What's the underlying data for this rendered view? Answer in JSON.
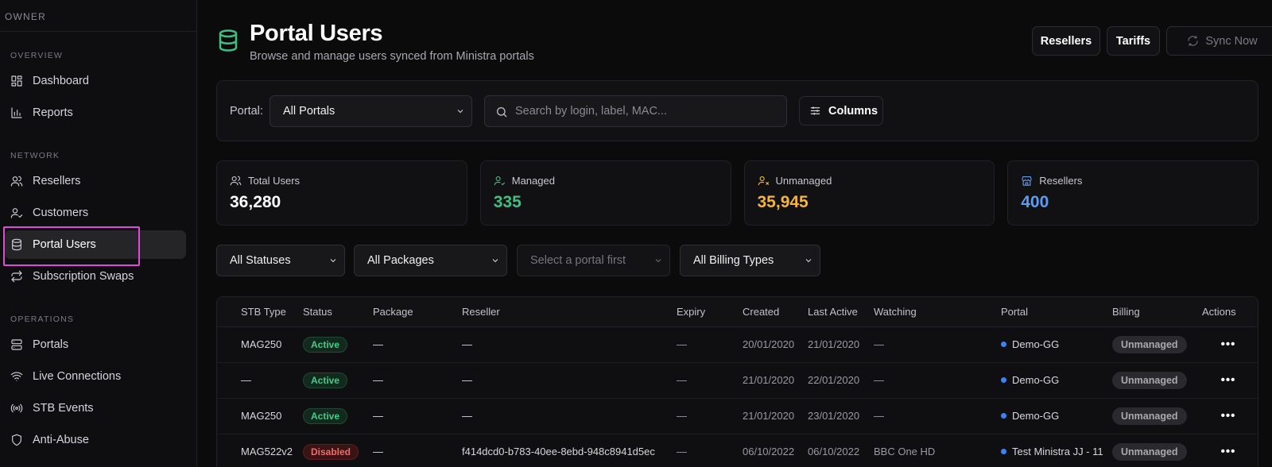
{
  "sidebar": {
    "owner": "OWNER",
    "sections": [
      {
        "label": "OVERVIEW",
        "items": [
          {
            "label": "Dashboard",
            "icon": "dashboard-icon"
          },
          {
            "label": "Reports",
            "icon": "bar-chart-icon"
          }
        ]
      },
      {
        "label": "NETWORK",
        "items": [
          {
            "label": "Resellers",
            "icon": "users-icon"
          },
          {
            "label": "Customers",
            "icon": "user-check-icon"
          },
          {
            "label": "Portal Users",
            "icon": "database-icon",
            "active": true
          },
          {
            "label": "Subscription Swaps",
            "icon": "repeat-icon"
          }
        ]
      },
      {
        "label": "OPERATIONS",
        "items": [
          {
            "label": "Portals",
            "icon": "server-icon"
          },
          {
            "label": "Live Connections",
            "icon": "wifi-icon"
          },
          {
            "label": "STB Events",
            "icon": "broadcast-icon"
          },
          {
            "label": "Anti-Abuse",
            "icon": "shield-icon"
          }
        ]
      }
    ]
  },
  "header": {
    "title": "Portal Users",
    "subtitle": "Browse and manage users synced from Ministra portals",
    "resellers_btn": "Resellers",
    "tariffs_btn": "Tariffs",
    "sync_btn": "Sync Now"
  },
  "filter_bar": {
    "portal_label": "Portal:",
    "portal_value": "All Portals",
    "search_placeholder": "Search by login, label, MAC...",
    "columns_btn": "Columns"
  },
  "stats": [
    {
      "label": "Total Users",
      "value": "36,280",
      "color": "#ffffff",
      "icon": "users-icon"
    },
    {
      "label": "Managed",
      "value": "335",
      "color": "#3fbf86",
      "icon": "user-check-icon"
    },
    {
      "label": "Unmanaged",
      "value": "35,945",
      "color": "#f5b638",
      "icon": "user-x-icon"
    },
    {
      "label": "Resellers",
      "value": "400",
      "color": "#5b9cf5",
      "icon": "store-icon"
    }
  ],
  "filters": {
    "status": "All Statuses",
    "packages": "All Packages",
    "portal_first": "Select a portal first",
    "billing": "All Billing Types"
  },
  "table": {
    "headers": [
      "STB Type",
      "Status",
      "Package",
      "Reseller",
      "Expiry",
      "Created",
      "Last Active",
      "Watching",
      "Portal",
      "Billing",
      "Actions"
    ],
    "rows": [
      {
        "stb": "MAG250",
        "status": "Active",
        "package": "—",
        "reseller": "—",
        "expiry": "—",
        "created": "20/01/2020",
        "last_active": "21/01/2020",
        "watching": "—",
        "portal": "Demo-GG",
        "billing": "Unmanaged"
      },
      {
        "stb": "—",
        "status": "Active",
        "package": "—",
        "reseller": "—",
        "expiry": "—",
        "created": "21/01/2020",
        "last_active": "22/01/2020",
        "watching": "—",
        "portal": "Demo-GG",
        "billing": "Unmanaged"
      },
      {
        "stb": "MAG250",
        "status": "Active",
        "package": "—",
        "reseller": "—",
        "expiry": "—",
        "created": "21/01/2020",
        "last_active": "23/01/2020",
        "watching": "—",
        "portal": "Demo-GG",
        "billing": "Unmanaged"
      },
      {
        "stb": "MAG522v2",
        "status": "Disabled",
        "package": "—",
        "reseller": "f414dcd0-b783-40ee-8ebd-948c8941d5ec",
        "expiry": "—",
        "created": "06/10/2022",
        "last_active": "06/10/2022",
        "watching": "BBC One HD",
        "portal": "Test Ministra JJ - 11",
        "billing": "Unmanaged"
      }
    ],
    "actions_glyph": "•••"
  }
}
